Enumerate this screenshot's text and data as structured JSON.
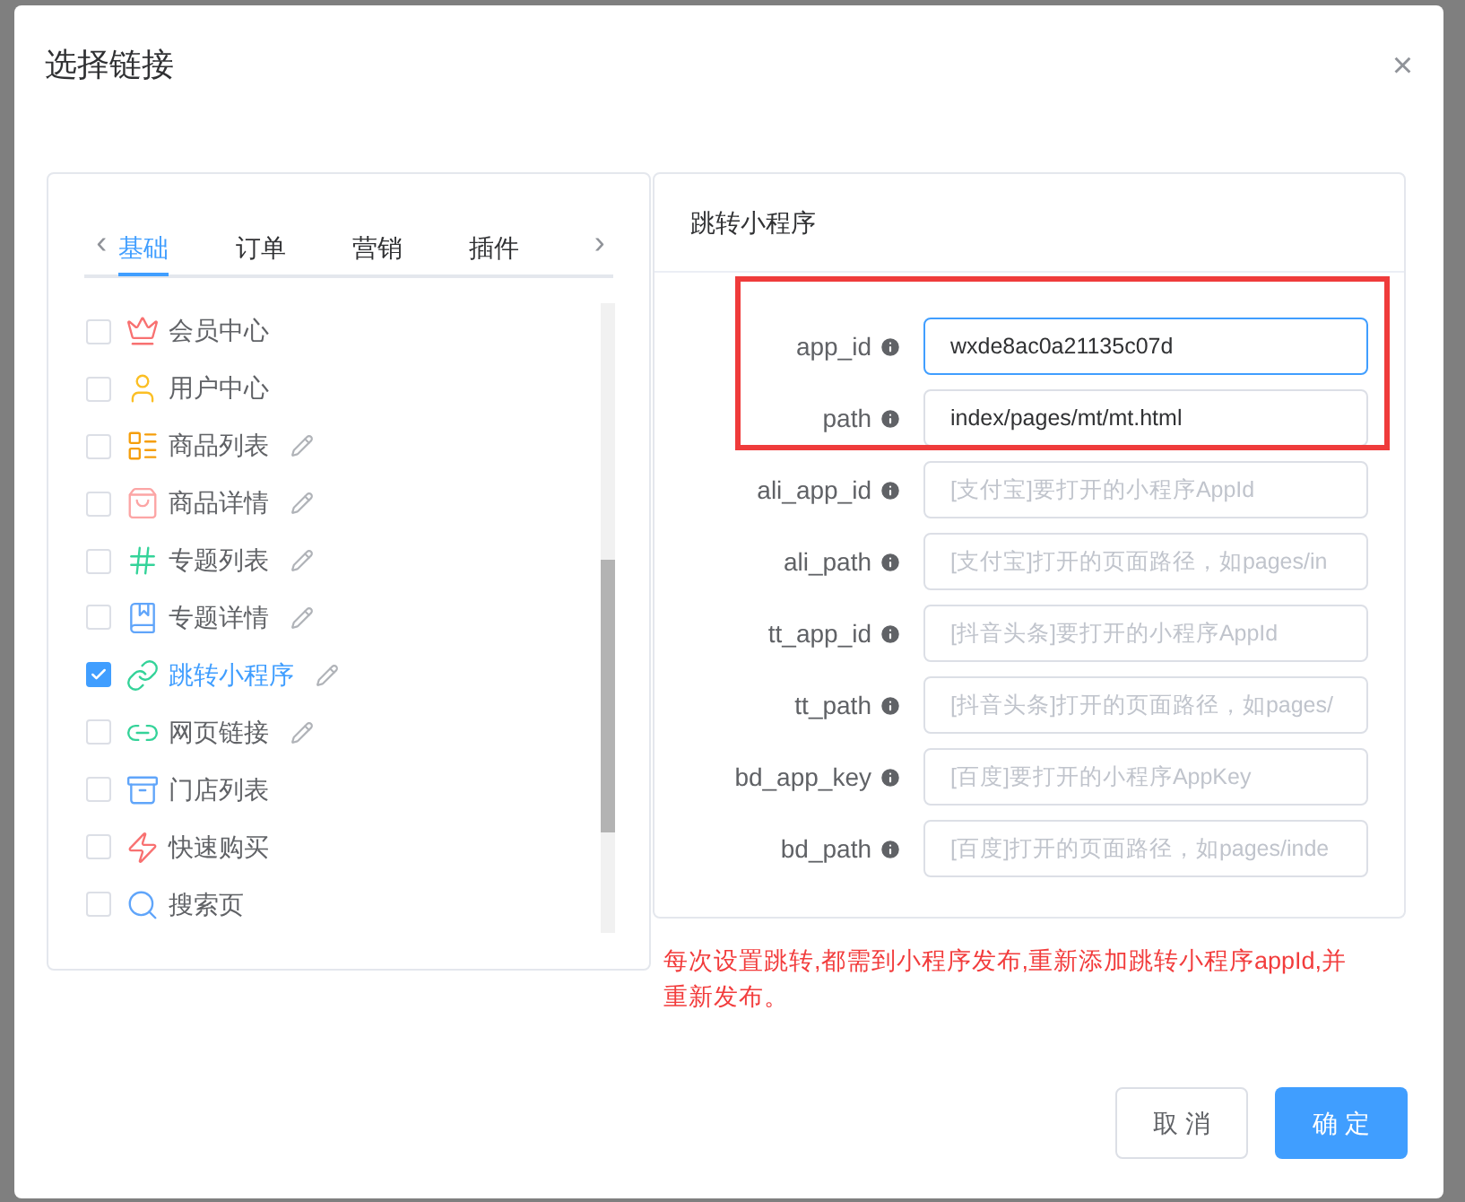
{
  "dialog": {
    "title": "选择链接",
    "close": "×"
  },
  "tabs": {
    "prev": "‹",
    "next": "›",
    "items": [
      {
        "label": "基础",
        "selected": true
      },
      {
        "label": "订单",
        "selected": false
      },
      {
        "label": "营销",
        "selected": false
      },
      {
        "label": "插件",
        "selected": false
      }
    ]
  },
  "links": [
    {
      "label": "会员中心",
      "checked": false,
      "editable": false
    },
    {
      "label": "用户中心",
      "checked": false,
      "editable": false
    },
    {
      "label": "商品列表",
      "checked": false,
      "editable": true
    },
    {
      "label": "商品详情",
      "checked": false,
      "editable": true
    },
    {
      "label": "专题列表",
      "checked": false,
      "editable": true
    },
    {
      "label": "专题详情",
      "checked": false,
      "editable": true
    },
    {
      "label": "跳转小程序",
      "checked": true,
      "editable": true
    },
    {
      "label": "网页链接",
      "checked": false,
      "editable": true
    },
    {
      "label": "门店列表",
      "checked": false,
      "editable": false
    },
    {
      "label": "快速购买",
      "checked": false,
      "editable": false
    },
    {
      "label": "搜索页",
      "checked": false,
      "editable": false
    }
  ],
  "form": {
    "title": "跳转小程序",
    "fields": [
      {
        "label": "app_id",
        "value": "wxde8ac0a21135c07d",
        "focused": true,
        "highlighted": true
      },
      {
        "label": "path",
        "value": "index/pages/mt/mt.html",
        "focused": false,
        "highlighted": true
      },
      {
        "label": "ali_app_id",
        "placeholder": "[支付宝]要打开的小程序AppId",
        "focused": false,
        "highlighted": false
      },
      {
        "label": "ali_path",
        "placeholder": "[支付宝]打开的页面路径，如pages/in",
        "focused": false,
        "highlighted": false
      },
      {
        "label": "tt_app_id",
        "placeholder": "[抖音头条]要打开的小程序AppId",
        "focused": false,
        "highlighted": false
      },
      {
        "label": "tt_path",
        "placeholder": "[抖音头条]打开的页面路径，如pages/",
        "focused": false,
        "highlighted": false
      },
      {
        "label": "bd_app_key",
        "placeholder": "[百度]要打开的小程序AppKey",
        "focused": false,
        "highlighted": false
      },
      {
        "label": "bd_path",
        "placeholder": "[百度]打开的页面路径，如pages/inde",
        "focused": false,
        "highlighted": false
      }
    ]
  },
  "note": "每次设置跳转,都需到小程序发布,重新添加跳转小程序appId,并重新发布。",
  "buttons": [
    {
      "label": "取 消",
      "kind": "secondary"
    },
    {
      "label": "确 定",
      "kind": "primary"
    }
  ]
}
